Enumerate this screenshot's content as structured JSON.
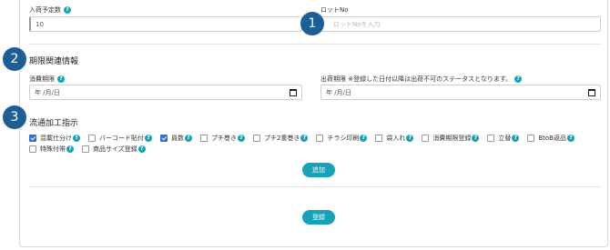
{
  "form": {
    "qty_label": "入荷予定数",
    "qty_value": "10",
    "lot_label": "ロットNo",
    "lot_placeholder": "ロットNoを入力"
  },
  "expiry_section": {
    "title": "期限関連情報",
    "consume_label": "消費期限",
    "consume_placeholder": "年 /月/日",
    "ship_label": "出荷期限 ※登録した日付以降は出荷不可のステータスとなります。",
    "ship_placeholder": "年 /月/日"
  },
  "processing_section": {
    "title": "流通加工指示",
    "options": [
      {
        "label": "混載仕分け",
        "checked": true
      },
      {
        "label": "バーコード貼付",
        "checked": false
      },
      {
        "label": "員数",
        "checked": true
      },
      {
        "label": "プチ巻き",
        "checked": false
      },
      {
        "label": "プチ2重巻き",
        "checked": false
      },
      {
        "label": "チラシ印刷",
        "checked": false
      },
      {
        "label": "袋入れ",
        "checked": false
      },
      {
        "label": "消費期限登録",
        "checked": false
      },
      {
        "label": "立替",
        "checked": false
      },
      {
        "label": "BtoB返品",
        "checked": false
      },
      {
        "label": "特殊付帯",
        "checked": false
      },
      {
        "label": "商品サイズ登録",
        "checked": false
      }
    ],
    "add_button": "追加"
  },
  "submit_button": "登録",
  "badges": {
    "one": "1",
    "two": "2",
    "three": "3"
  },
  "help_icon": "?",
  "colors": {
    "accent": "#17a2b8",
    "badge": "#1d5e96",
    "checkbox": "#2f6fd6"
  }
}
